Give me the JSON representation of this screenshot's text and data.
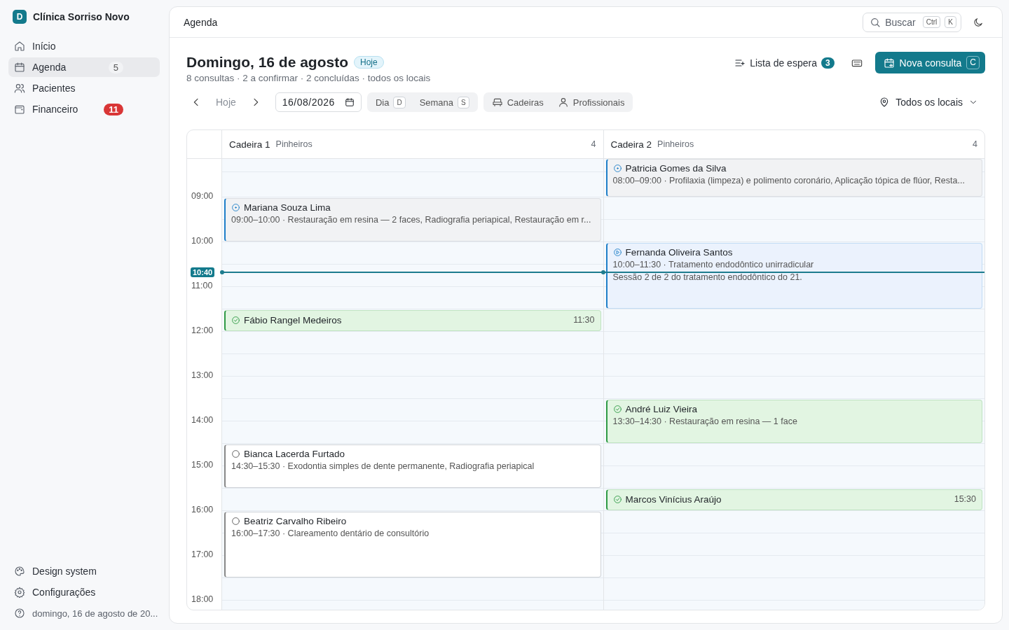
{
  "sidebar": {
    "brand": {
      "initial": "D",
      "name": "Clínica Sorriso Novo"
    },
    "items": [
      {
        "label": "Início",
        "selected": false
      },
      {
        "label": "Agenda",
        "selected": true,
        "count": "5"
      },
      {
        "label": "Pacientes",
        "selected": false
      },
      {
        "label": "Financeiro",
        "selected": false,
        "alert": "11"
      }
    ],
    "footer_items": [
      {
        "label": "Design system"
      },
      {
        "label": "Configurações"
      },
      {
        "label": "domingo, 16 de agosto de 20..."
      }
    ]
  },
  "topbar": {
    "title": "Agenda",
    "search": {
      "placeholder": "Buscar",
      "keys": [
        "Ctrl",
        "K"
      ]
    }
  },
  "header": {
    "title": "Domingo, 16 de agosto",
    "badge": "Hoje",
    "summary": "8 consultas · 2 a confirmar · 2 concluídas · todos os locais",
    "waitlist": {
      "label": "Lista de espera",
      "count": "3"
    },
    "primary": {
      "label": "Nova consulta",
      "key": "C"
    }
  },
  "toolbar": {
    "today": "Hoje",
    "date": "16/08/2026",
    "views": [
      {
        "label": "Dia",
        "key": "D"
      },
      {
        "label": "Semana",
        "key": "S"
      }
    ],
    "groupings": [
      {
        "label": "Cadeiras"
      },
      {
        "label": "Profissionais"
      }
    ],
    "location": "Todos os locais"
  },
  "calendar": {
    "now": "10:40",
    "hours": [
      "09:00",
      "10:00",
      "11:00",
      "12:00",
      "13:00",
      "14:00",
      "15:00",
      "16:00",
      "17:00",
      "18:00"
    ],
    "columns": [
      {
        "name": "Cadeira 1",
        "place": "Pinheiros",
        "count": "4",
        "events": [
          {
            "kind": "confirmed",
            "patient": "Mariana Souza Lima",
            "detail": "09:00–10:00 · Restauração em resina — 2 faces, Radiografia periapical, Restauração em r..."
          },
          {
            "kind": "done",
            "patient": "Fábio Rangel Medeiros",
            "time": "11:30"
          },
          {
            "kind": "pending",
            "patient": "Bianca Lacerda Furtado",
            "detail": "14:30–15:30 · Exodontia simples de dente permanente, Radiografia periapical"
          },
          {
            "kind": "pending",
            "patient": "Beatriz Carvalho Ribeiro",
            "detail": "16:00–17:30 · Clareamento dentário de consultório"
          }
        ]
      },
      {
        "name": "Cadeira 2",
        "place": "Pinheiros",
        "count": "4",
        "events": [
          {
            "kind": "confirmed",
            "patient": "Patricia Gomes da Silva",
            "detail": "08:00–09:00 · Profilaxia (limpeza) e polimento coronário, Aplicação tópica de flúor, Resta..."
          },
          {
            "kind": "active",
            "patient": "Fernanda Oliveira Santos",
            "detail": "10:00–11:30 · Tratamento endodôntico unirradicular",
            "note": "Sessão 2 de 2 do tratamento endodôntico do 21."
          },
          {
            "kind": "done",
            "patient": "André Luiz Vieira",
            "detail": "13:30–14:30 · Restauração em resina — 1 face"
          },
          {
            "kind": "done",
            "patient": "Marcos Vinícius Araújo",
            "time": "15:30"
          }
        ]
      }
    ]
  }
}
